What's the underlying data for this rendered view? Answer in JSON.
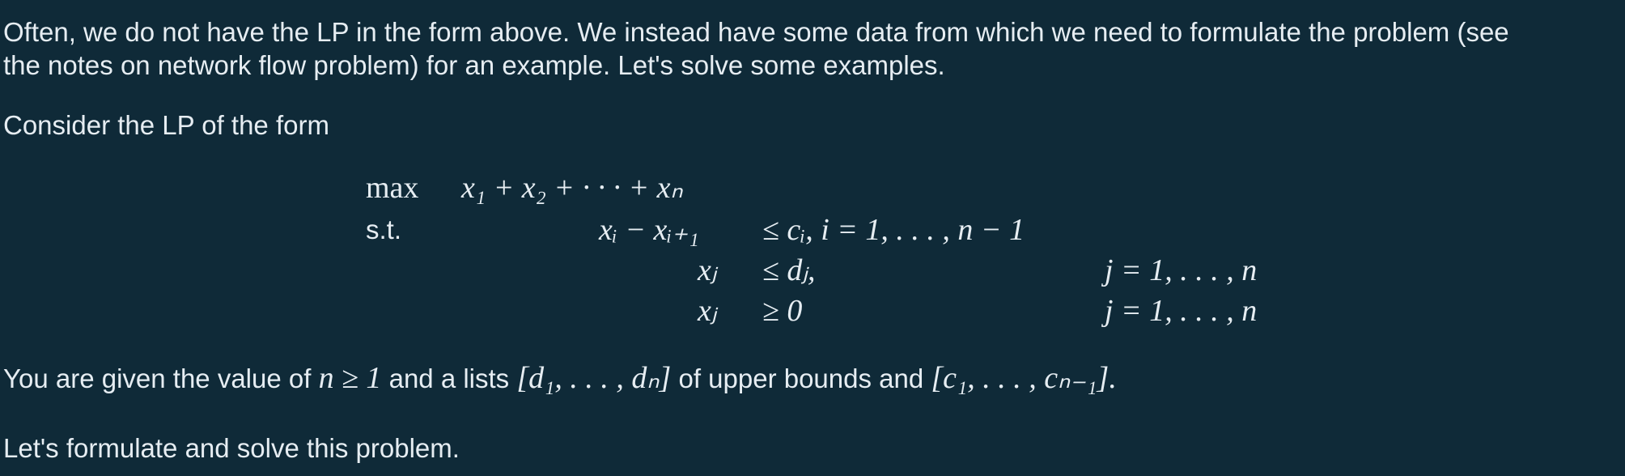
{
  "paragraphs": {
    "intro_line1": "Often, we do not have the LP in the form above. We instead have some data from which we need to formulate the problem (see",
    "intro_line2": "the notes on network flow problem) for an example. Let's solve some examples.",
    "consider": "Consider the LP of the form",
    "given_prefix": "You are given the value of ",
    "given_n_cond": "n ≥ 1",
    "given_mid": " and a lists ",
    "given_d_list": "[d₁, . . . , dₙ]",
    "given_mid2": " of upper bounds and ",
    "given_c_list": "[c₁, . . . , cₙ₋₁].",
    "formulate": "Let's formulate and solve this problem."
  },
  "lp": {
    "max_label": "max",
    "objective": "x₁ + x₂ + · · · + xₙ",
    "st_label": "s.t.",
    "rows": [
      {
        "lhs": "xᵢ − xᵢ₊₁",
        "rel": "≤ cᵢ, i = 1, . . . , n − 1",
        "range": ""
      },
      {
        "lhs": "xⱼ",
        "rel": "≤ dⱼ,",
        "range": "j = 1, . . . , n"
      },
      {
        "lhs": "xⱼ",
        "rel": "≥ 0",
        "range": "j = 1, . . . , n"
      }
    ]
  },
  "colors": {
    "background": "#0f2a38",
    "text": "#e6edf2"
  }
}
